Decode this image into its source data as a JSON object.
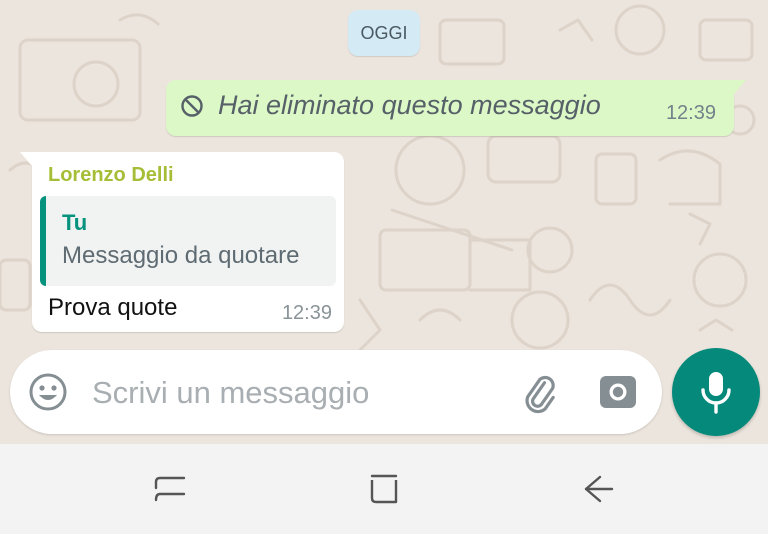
{
  "chat": {
    "date_chip": "OGGI",
    "outgoing": {
      "deleted_text": "Hai eliminato questo messaggio",
      "time": "12:39",
      "icon": "blocked-icon"
    },
    "incoming": {
      "sender": "Lorenzo Delli",
      "quote_author": "Tu",
      "quote_text": "Messaggio da quotare",
      "text": "Prova quote",
      "time": "12:39"
    }
  },
  "composer": {
    "placeholder": "Scrivi un messaggio",
    "icons": [
      "emoji-icon",
      "paperclip-icon",
      "camera-icon",
      "microphone-icon"
    ]
  },
  "navigation": {
    "icons": [
      "recent-apps-icon",
      "home-icon",
      "back-icon"
    ]
  },
  "colors": {
    "chat_background": "#ece5dd",
    "outgoing_bubble": "#dcf8c6",
    "incoming_bubble": "#ffffff",
    "date_chip": "#d4eaf4",
    "accent_teal": "#05897b",
    "sender_name": "#a6be37",
    "navigation_bar": "#f3f3f3"
  }
}
